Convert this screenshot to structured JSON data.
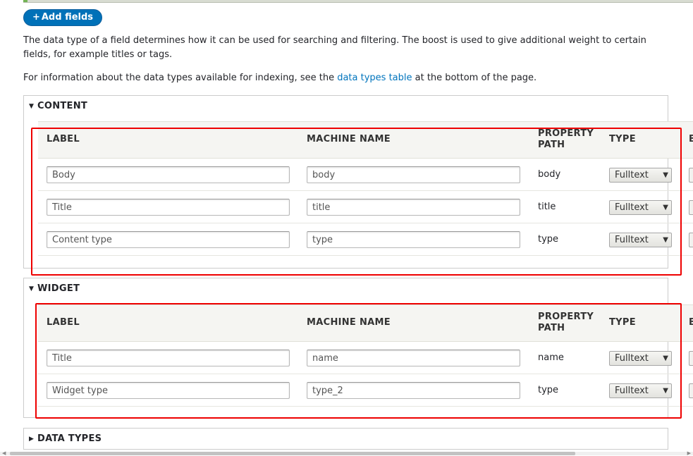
{
  "toolbar": {
    "add_fields_label": "Add fields",
    "add_fields_icon": "+"
  },
  "description": {
    "line1": "The data type of a field determines how it can be used for searching and filtering. The boost is used to give additional weight to certain fields, for example titles or tags.",
    "line2_prefix": "For information about the data types available for indexing, see the ",
    "line2_link": "data types table",
    "line2_suffix": " at the bottom of the page."
  },
  "columns": {
    "label": "LABEL",
    "machine_name": "MACHINE NAME",
    "property_path_1": "PROPERTY",
    "property_path_2": "PATH",
    "type": "TYPE",
    "boost_cut": "B"
  },
  "sections": {
    "content": {
      "title": "CONTENT",
      "rows": [
        {
          "label": "Body",
          "machine_name": "body",
          "property_path": "body",
          "type": "Fulltext"
        },
        {
          "label": "Title",
          "machine_name": "title",
          "property_path": "title",
          "type": "Fulltext"
        },
        {
          "label": "Content type",
          "machine_name": "type",
          "property_path": "type",
          "type": "Fulltext"
        }
      ]
    },
    "widget": {
      "title": "WIDGET",
      "rows": [
        {
          "label": "Title",
          "machine_name": "name",
          "property_path": "name",
          "type": "Fulltext"
        },
        {
          "label": "Widget type",
          "machine_name": "type_2",
          "property_path": "type",
          "type": "Fulltext"
        }
      ]
    },
    "data_types": {
      "title": "DATA TYPES"
    }
  },
  "icons": {
    "expanded": "triangle-down-icon",
    "collapsed": "triangle-right-icon",
    "select_arrow": "chevron-down-icon"
  },
  "colors": {
    "accent": "#0071b8",
    "highlight": "#e00000",
    "link": "#0074bd"
  }
}
